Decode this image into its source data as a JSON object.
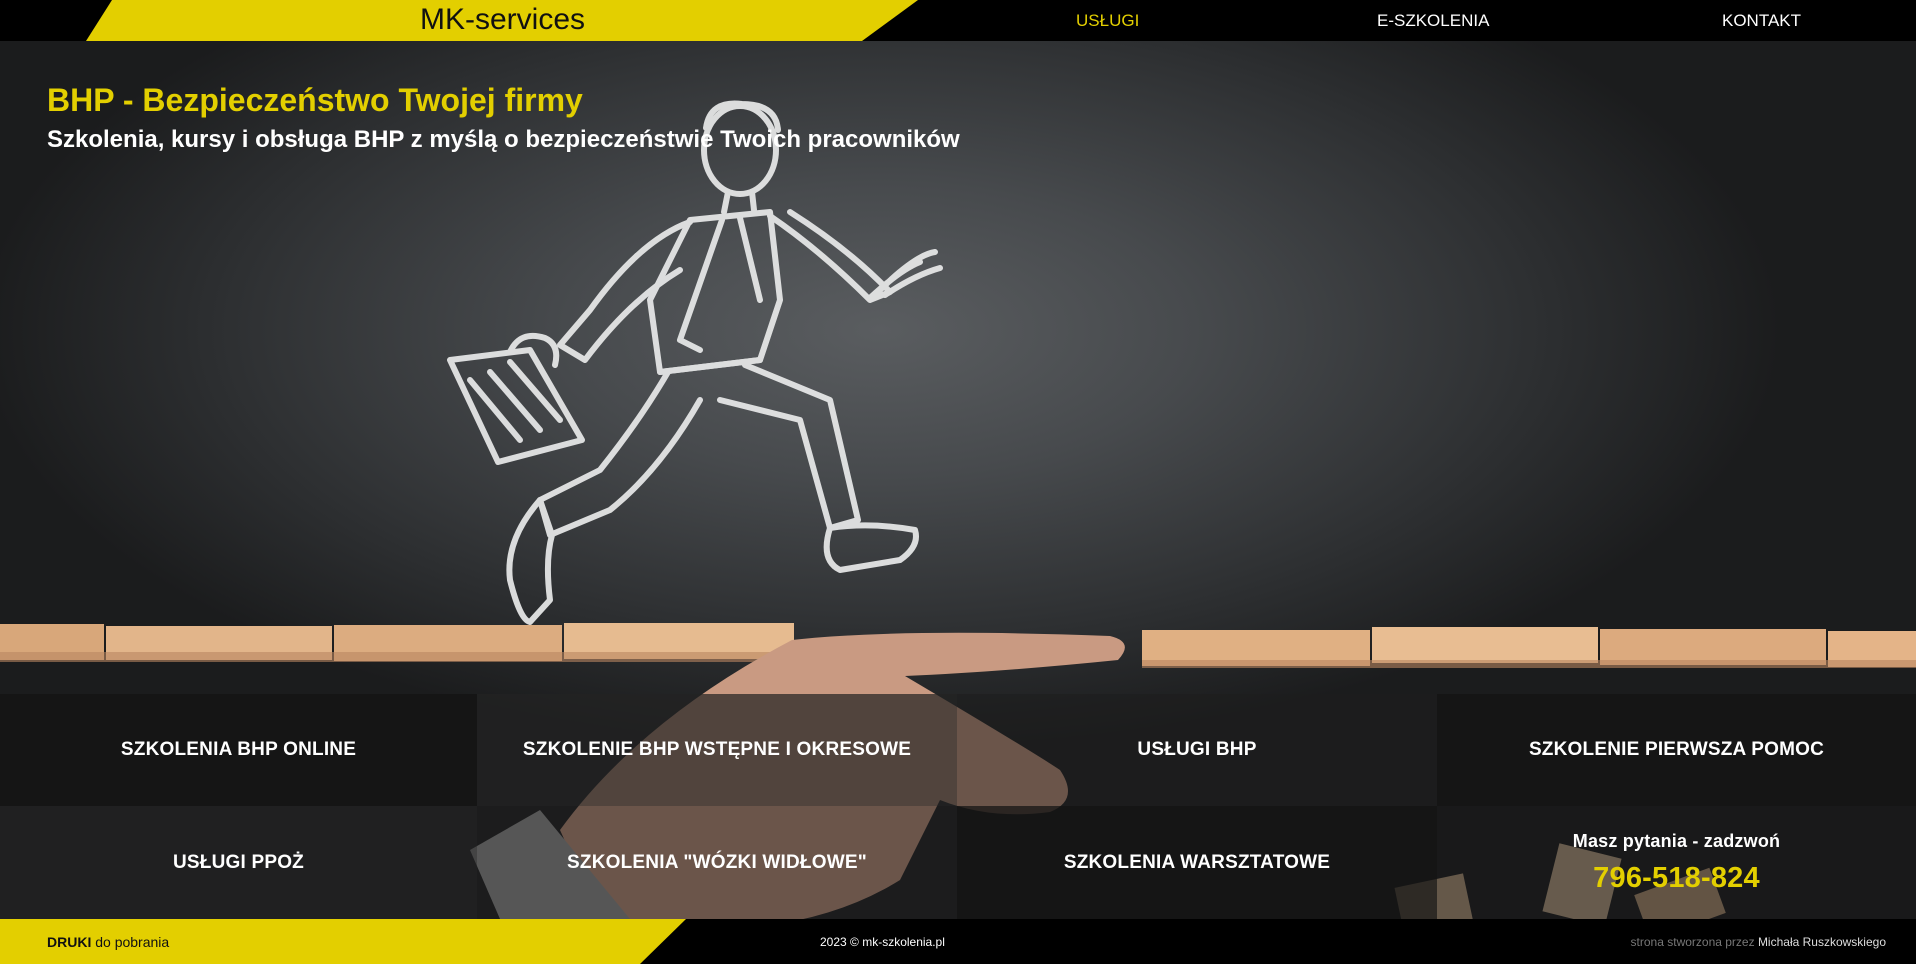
{
  "colors": {
    "accent": "#e3cf00",
    "background": "#000000"
  },
  "brand": {
    "name": "MK-services"
  },
  "nav": {
    "items": [
      {
        "label": "USŁUGI",
        "active": true
      },
      {
        "label": "E-SZKOLENIA",
        "active": false
      },
      {
        "label": "KONTAKT",
        "active": false
      }
    ]
  },
  "hero": {
    "title": "BHP - Bezpieczeństwo Twojej firmy",
    "subtitle": "Szkolenia, kursy i obsługa BHP z myślą o bezpieczeństwie Twoich pracowników",
    "image_description_icon": "chalk-businessman-running-icon"
  },
  "tiles": [
    "SZKOLENIA BHP ONLINE",
    "SZKOLENIE BHP WSTĘPNE I OKRESOWE",
    "USŁUGI BHP",
    "SZKOLENIE PIERWSZA POMOC",
    "USŁUGI PPOŻ",
    "SZKOLENIA \"WÓZKI WIDŁOWE\"",
    "SZKOLENIA WARSZTATOWE"
  ],
  "contact": {
    "question": "Masz pytania - zadzwoń",
    "phone": "796-518-824"
  },
  "footer": {
    "druki_bold": "DRUKI",
    "druki_rest": " do pobrania",
    "copyright": "2023 © mk-szkolenia.pl",
    "credit_prefix": "strona stworzona przez ",
    "credit_author": "Michała Ruszkowskiego"
  }
}
